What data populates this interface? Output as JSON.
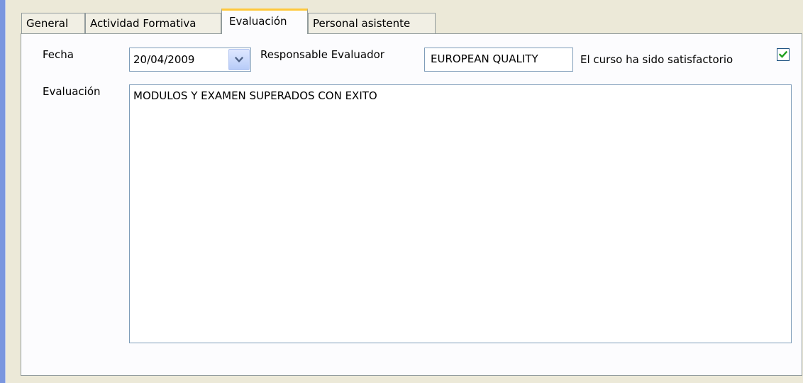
{
  "tabs": {
    "general": "General",
    "actividad": "Actividad Formativa",
    "evaluacion": "Evaluación",
    "personal": "Personal asistente",
    "active": "Evaluación"
  },
  "form": {
    "fecha_label": "Fecha",
    "fecha_value": "20/04/2009",
    "responsable_label": "Responsable Evaluador",
    "responsable_value": "EUROPEAN QUALITY",
    "satisfactorio_label": "El curso ha sido satisfactorio",
    "satisfactorio_checked": true,
    "evaluacion_label": "Evaluación",
    "evaluacion_value": "MODULOS Y EXAMEN SUPERADOS CON EXITO"
  },
  "icons": {
    "dropdown": "chevron-down-icon",
    "check": "check-icon"
  },
  "colors": {
    "active_tab_accent": "#ffc83c",
    "window_bg": "#ece9d8",
    "input_border": "#7f9db9",
    "check_color": "#21a121"
  }
}
